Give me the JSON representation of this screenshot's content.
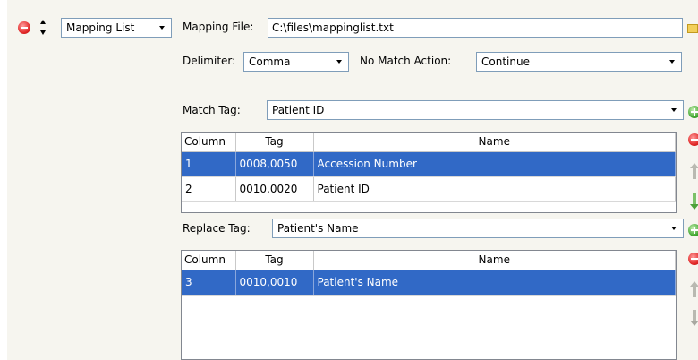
{
  "rule": {
    "type_selected": "Mapping List",
    "mapping_file_label": "Mapping File:",
    "mapping_file_value": "C:\\files\\mappinglist.txt",
    "delimiter_label": "Delimiter:",
    "delimiter_value": "Comma",
    "no_match_label": "No Match Action:",
    "no_match_value": "Continue"
  },
  "match": {
    "label": "Match Tag:",
    "value": "Patient ID",
    "columns": [
      "Column",
      "Tag",
      "Name"
    ],
    "rows": [
      {
        "column": "1",
        "tag": "0008,0050",
        "name": "Accession Number",
        "selected": true
      },
      {
        "column": "2",
        "tag": "0010,0020",
        "name": "Patient ID",
        "selected": false
      }
    ]
  },
  "replace": {
    "label": "Replace Tag:",
    "value": "Patient's Name",
    "columns": [
      "Column",
      "Tag",
      "Name"
    ],
    "rows": [
      {
        "column": "3",
        "tag": "0010,0010",
        "name": "Patient's Name",
        "selected": true
      }
    ]
  },
  "icons": {
    "remove": "minus-circle-icon",
    "reorder": "up-down-arrows-icon",
    "browse": "folder-icon",
    "add": "plus-circle-icon",
    "move_up": "arrow-up-icon",
    "move_down": "arrow-down-icon"
  },
  "colors": {
    "selection": "#3169c6",
    "panel": "#f6f5ef",
    "add": "#3fa52e",
    "remove": "#e02424"
  }
}
